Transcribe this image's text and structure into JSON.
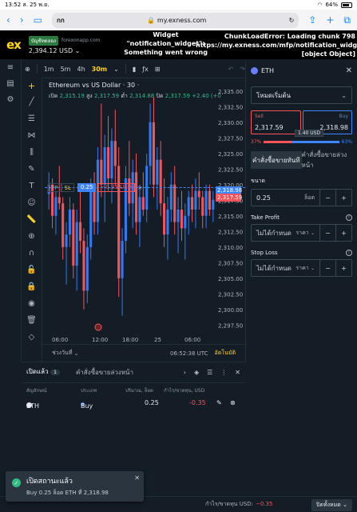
{
  "ios": {
    "time": "13:52",
    "date": "ส. 25 พ.ย.",
    "battery": "64%"
  },
  "safari": {
    "aa": "กก",
    "url": "my.exness.com"
  },
  "header": {
    "logo": "ex",
    "demo_badge": "บัญชีทดลอง",
    "server": "forexonapp.com",
    "balance": "2,394.12 USD",
    "error_widget": "Widget \"notification_widget\": Something went wrong",
    "error_chunk": "ChunkLoadError: Loading chunk 798 https://my.exness.com/mfp/notification_widget [object Object]"
  },
  "chart_toolbar": {
    "timeframes": [
      "1m",
      "5m",
      "4h",
      "30m"
    ],
    "selected": "30m"
  },
  "chart_data": {
    "type": "candlestick",
    "title": "Ethereum vs US Dollar · 30 ·",
    "ohlc": {
      "o_label": "เปิด",
      "o": "2,315.19",
      "h_label": "สูง",
      "h": "2,317.59",
      "l_label": "ต่ำ",
      "l": "2,314.88",
      "c_label": "ปิด",
      "c": "2,317.59",
      "change": "+2.40 (+0"
    },
    "y_ticks": [
      "2,335.00",
      "2,332.50",
      "2,330.00",
      "2,327.50",
      "2,325.00",
      "2,322.50",
      "2,320.00",
      "2,317.50",
      "2,315.00",
      "2,312.50",
      "2,310.00",
      "2,307.50",
      "2,305.00",
      "2,302.50",
      "2,300.00",
      "2,297.50"
    ],
    "ylim": [
      2296,
      2336
    ],
    "x_ticks": [
      "06:00",
      "12:00",
      "18:00",
      "25",
      "06:00"
    ],
    "current_bid": "2,317.59",
    "current_ask": "2,318.98",
    "candles": [
      [
        2318.5,
        2322,
        2316,
        2320
      ],
      [
        2320,
        2321,
        2313,
        2315
      ],
      [
        2315,
        2319,
        2312,
        2318
      ],
      [
        2318,
        2323,
        2316,
        2317
      ],
      [
        2317,
        2318,
        2308,
        2310
      ],
      [
        2310,
        2314,
        2304,
        2312
      ],
      [
        2312,
        2318,
        2310,
        2316
      ],
      [
        2316,
        2317,
        2305,
        2307
      ],
      [
        2307,
        2316,
        2303,
        2314
      ],
      [
        2314,
        2319,
        2309,
        2311
      ],
      [
        2311,
        2313,
        2300,
        2303
      ],
      [
        2303,
        2312,
        2301,
        2310
      ],
      [
        2310,
        2321,
        2308,
        2319
      ],
      [
        2319,
        2322,
        2312,
        2314
      ],
      [
        2314,
        2326,
        2312,
        2324
      ],
      [
        2324,
        2333,
        2318,
        2320
      ],
      [
        2320,
        2328,
        2314,
        2326
      ],
      [
        2326,
        2331,
        2319,
        2321
      ],
      [
        2321,
        2329,
        2317,
        2327
      ],
      [
        2327,
        2332,
        2320,
        2323
      ],
      [
        2323,
        2326,
        2302,
        2305
      ],
      [
        2305,
        2313,
        2299,
        2311
      ],
      [
        2311,
        2323,
        2309,
        2321
      ],
      [
        2321,
        2327,
        2315,
        2317
      ],
      [
        2317,
        2324,
        2313,
        2322
      ],
      [
        2322,
        2325,
        2312,
        2314
      ],
      [
        2314,
        2320,
        2310,
        2318
      ],
      [
        2318,
        2322,
        2315,
        2316
      ],
      [
        2316,
        2325,
        2314,
        2323
      ],
      [
        2323,
        2333,
        2320,
        2330
      ],
      [
        2330,
        2334,
        2318,
        2320
      ],
      [
        2320,
        2326,
        2316,
        2324
      ],
      [
        2324,
        2327,
        2315,
        2317
      ],
      [
        2317,
        2321,
        2310,
        2312
      ],
      [
        2312,
        2318,
        2308,
        2316
      ],
      [
        2316,
        2322,
        2314,
        2320
      ],
      [
        2320,
        2323,
        2312,
        2314
      ],
      [
        2314,
        2318,
        2309,
        2316
      ],
      [
        2316,
        2319,
        2311,
        2313
      ],
      [
        2313,
        2317,
        2308,
        2315
      ],
      [
        2315,
        2319,
        2312,
        2318
      ],
      [
        2318,
        2320,
        2314,
        2316
      ],
      [
        2316,
        2321,
        2313,
        2319
      ],
      [
        2319,
        2322,
        2316,
        2318
      ],
      [
        2318,
        2319,
        2313,
        2315
      ],
      [
        2315,
        2320,
        2313,
        2319
      ],
      [
        2319,
        2320,
        2315,
        2316
      ],
      [
        2316,
        2319,
        2314,
        2317.59
      ]
    ]
  },
  "trade_tag": {
    "tp": "TP",
    "sl": "SL",
    "volume": "0.25",
    "pnl": "−0.35 USD",
    "close": "×"
  },
  "chart_bottom": {
    "range_label": "ช่วงวันที่",
    "time": "06:52:38 UTC",
    "auto": "อัตโนมัติ"
  },
  "panel": {
    "symbol": "ETH",
    "order_type": "โหมดเริ่มต้น",
    "sell_label": "Sell",
    "sell_price": "2,317.59",
    "buy_label": "Buy",
    "buy_price": "2,318.98",
    "spread": "1.40 USD",
    "sell_pct": "37%",
    "buy_pct": "63%",
    "tab_market": "คำสั่งซื้อขายทันที",
    "tab_pending": "คำสั่งซื้อขายล่วงหน้า",
    "volume_label": "ขนาด",
    "volume_value": "0.25",
    "volume_unit": "ล็อต",
    "tp_label": "Take Profit",
    "tp_value": "ไม่ได้กำหนด",
    "tp_unit": "ราคา",
    "sl_label": "Stop Loss",
    "sl_value": "ไม่ได้กำหนด",
    "sl_unit": "ราคา"
  },
  "positions": {
    "tab_open": "เปิดแล้ว",
    "open_count": "1",
    "tab_pending": "คำสั่งซื้อขายล่วงหน้า",
    "headers": {
      "symbol": "สัญลักษณ์",
      "type": "ประเภท",
      "volume": "ปริมาณ, ล็อต",
      "pnl": "กำไร/ขาดทุน, USD"
    },
    "row": {
      "symbol": "ETH",
      "type": "Buy",
      "volume": "0.25",
      "pnl": "-0.35"
    }
  },
  "footer": {
    "pl_label": "กำไร/ขาดทุน USD:",
    "pl_value": "−0.35",
    "close_all": "ปิดทั้งหมด"
  },
  "toast": {
    "title": "เปิดสถานะแล้ว",
    "message": "Buy 0.25 ล็อต ETH ที่ 2,318.98"
  }
}
